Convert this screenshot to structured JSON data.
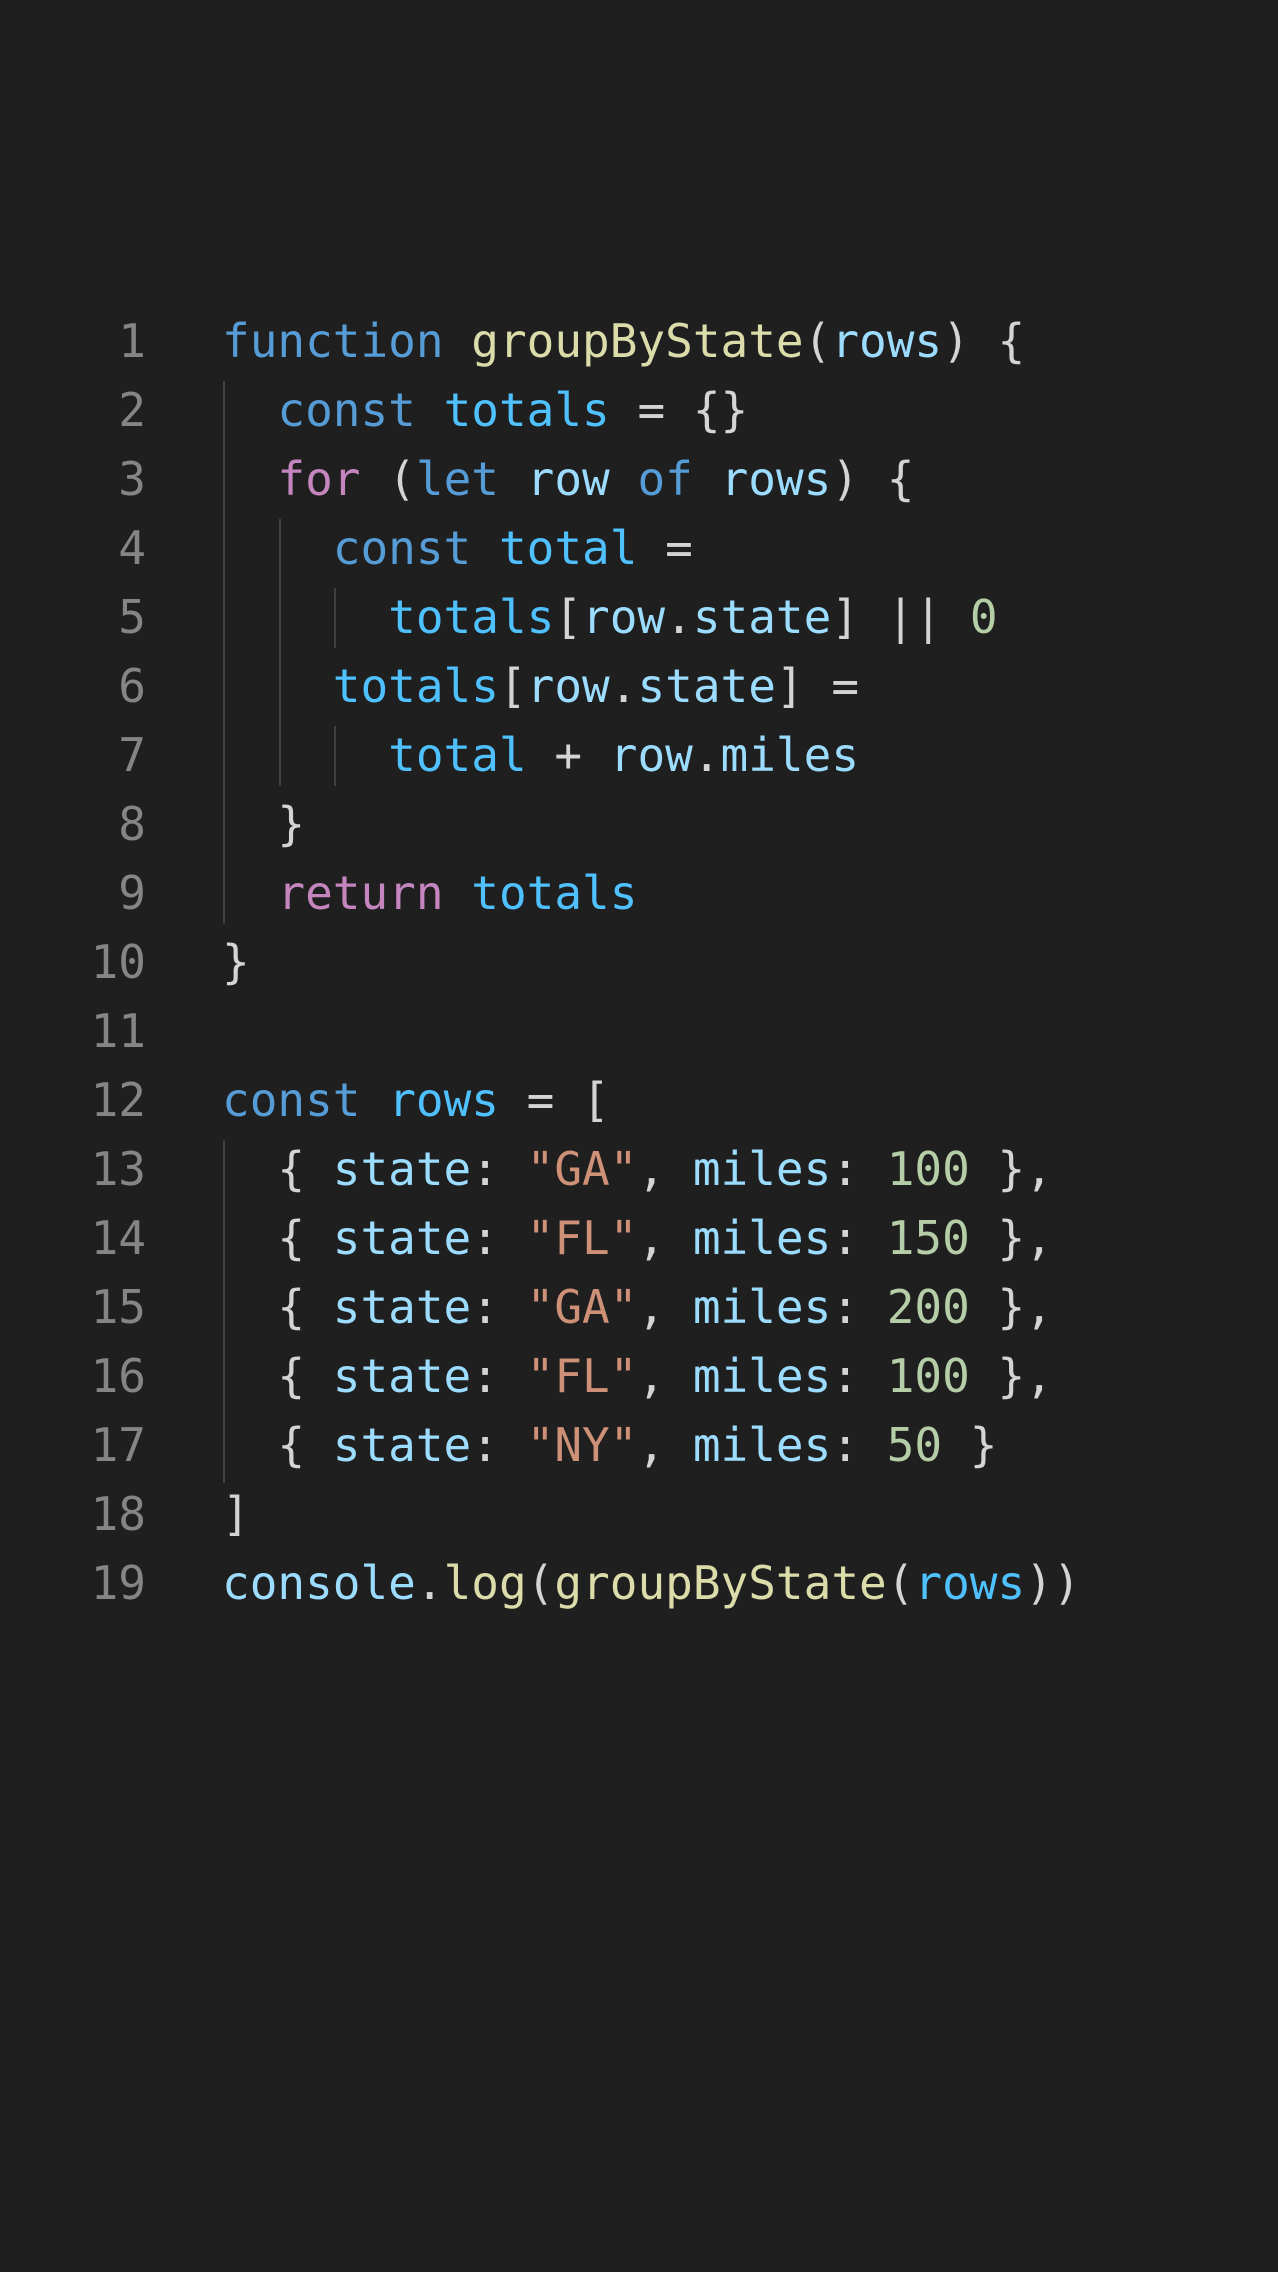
{
  "editor": {
    "language": "javascript",
    "colors": {
      "background": "#1f1f1f",
      "line_number": "#858585",
      "keyword": "#569cd6",
      "control": "#c586c0",
      "function": "#dcdcaa",
      "variable": "#4fc1ff",
      "property": "#9cdcfe",
      "string": "#ce9178",
      "number": "#b5cea8",
      "punctuation": "#d4d4d4"
    },
    "lines": [
      {
        "n": "1",
        "tokens": [
          [
            "kw",
            "function"
          ],
          [
            "op",
            " "
          ],
          [
            "fn",
            "groupByState"
          ],
          [
            "op",
            "("
          ],
          [
            "prop",
            "rows"
          ],
          [
            "op",
            ") {"
          ]
        ]
      },
      {
        "n": "2",
        "tokens": [
          [
            "op",
            "  "
          ],
          [
            "kw",
            "const"
          ],
          [
            "op",
            " "
          ],
          [
            "var",
            "totals"
          ],
          [
            "op",
            " = {}"
          ]
        ]
      },
      {
        "n": "3",
        "tokens": [
          [
            "op",
            "  "
          ],
          [
            "ctrl",
            "for"
          ],
          [
            "op",
            " ("
          ],
          [
            "kw",
            "let"
          ],
          [
            "op",
            " "
          ],
          [
            "prop",
            "row"
          ],
          [
            "op",
            " "
          ],
          [
            "kw",
            "of"
          ],
          [
            "op",
            " "
          ],
          [
            "prop",
            "rows"
          ],
          [
            "op",
            ") {"
          ]
        ]
      },
      {
        "n": "4",
        "tokens": [
          [
            "op",
            "    "
          ],
          [
            "kw",
            "const"
          ],
          [
            "op",
            " "
          ],
          [
            "var",
            "total"
          ],
          [
            "op",
            " ="
          ]
        ]
      },
      {
        "n": "5",
        "tokens": [
          [
            "op",
            "      "
          ],
          [
            "var",
            "totals"
          ],
          [
            "op",
            "["
          ],
          [
            "prop",
            "row"
          ],
          [
            "op",
            "."
          ],
          [
            "prop",
            "state"
          ],
          [
            "op",
            "] || "
          ],
          [
            "num",
            "0"
          ]
        ]
      },
      {
        "n": "6",
        "tokens": [
          [
            "op",
            "    "
          ],
          [
            "var",
            "totals"
          ],
          [
            "op",
            "["
          ],
          [
            "prop",
            "row"
          ],
          [
            "op",
            "."
          ],
          [
            "prop",
            "state"
          ],
          [
            "op",
            "] ="
          ]
        ]
      },
      {
        "n": "7",
        "tokens": [
          [
            "op",
            "      "
          ],
          [
            "var",
            "total"
          ],
          [
            "op",
            " + "
          ],
          [
            "prop",
            "row"
          ],
          [
            "op",
            "."
          ],
          [
            "prop",
            "miles"
          ]
        ]
      },
      {
        "n": "8",
        "tokens": [
          [
            "op",
            "  }"
          ]
        ]
      },
      {
        "n": "9",
        "tokens": [
          [
            "op",
            "  "
          ],
          [
            "ctrl",
            "return"
          ],
          [
            "op",
            " "
          ],
          [
            "var",
            "totals"
          ]
        ]
      },
      {
        "n": "10",
        "tokens": [
          [
            "op",
            "}"
          ]
        ]
      },
      {
        "n": "11",
        "tokens": []
      },
      {
        "n": "12",
        "tokens": [
          [
            "kw",
            "const"
          ],
          [
            "op",
            " "
          ],
          [
            "var",
            "rows"
          ],
          [
            "op",
            " = ["
          ]
        ]
      },
      {
        "n": "13",
        "tokens": [
          [
            "op",
            "  { "
          ],
          [
            "prop",
            "state"
          ],
          [
            "op",
            ": "
          ],
          [
            "str",
            "\"GA\""
          ],
          [
            "op",
            ", "
          ],
          [
            "prop",
            "miles"
          ],
          [
            "op",
            ": "
          ],
          [
            "num",
            "100"
          ],
          [
            "op",
            " },"
          ]
        ]
      },
      {
        "n": "14",
        "tokens": [
          [
            "op",
            "  { "
          ],
          [
            "prop",
            "state"
          ],
          [
            "op",
            ": "
          ],
          [
            "str",
            "\"FL\""
          ],
          [
            "op",
            ", "
          ],
          [
            "prop",
            "miles"
          ],
          [
            "op",
            ": "
          ],
          [
            "num",
            "150"
          ],
          [
            "op",
            " },"
          ]
        ]
      },
      {
        "n": "15",
        "tokens": [
          [
            "op",
            "  { "
          ],
          [
            "prop",
            "state"
          ],
          [
            "op",
            ": "
          ],
          [
            "str",
            "\"GA\""
          ],
          [
            "op",
            ", "
          ],
          [
            "prop",
            "miles"
          ],
          [
            "op",
            ": "
          ],
          [
            "num",
            "200"
          ],
          [
            "op",
            " },"
          ]
        ]
      },
      {
        "n": "16",
        "tokens": [
          [
            "op",
            "  { "
          ],
          [
            "prop",
            "state"
          ],
          [
            "op",
            ": "
          ],
          [
            "str",
            "\"FL\""
          ],
          [
            "op",
            ", "
          ],
          [
            "prop",
            "miles"
          ],
          [
            "op",
            ": "
          ],
          [
            "num",
            "100"
          ],
          [
            "op",
            " },"
          ]
        ]
      },
      {
        "n": "17",
        "tokens": [
          [
            "op",
            "  { "
          ],
          [
            "prop",
            "state"
          ],
          [
            "op",
            ": "
          ],
          [
            "str",
            "\"NY\""
          ],
          [
            "op",
            ", "
          ],
          [
            "prop",
            "miles"
          ],
          [
            "op",
            ": "
          ],
          [
            "num",
            "50"
          ],
          [
            "op",
            " }"
          ]
        ]
      },
      {
        "n": "18",
        "tokens": [
          [
            "op",
            "]"
          ]
        ]
      },
      {
        "n": "19",
        "tokens": [
          [
            "prop",
            "console"
          ],
          [
            "op",
            "."
          ],
          [
            "fn",
            "log"
          ],
          [
            "op",
            "("
          ],
          [
            "fn",
            "groupByState"
          ],
          [
            "op",
            "("
          ],
          [
            "var",
            "rows"
          ],
          [
            "op",
            "))"
          ]
        ]
      }
    ]
  }
}
